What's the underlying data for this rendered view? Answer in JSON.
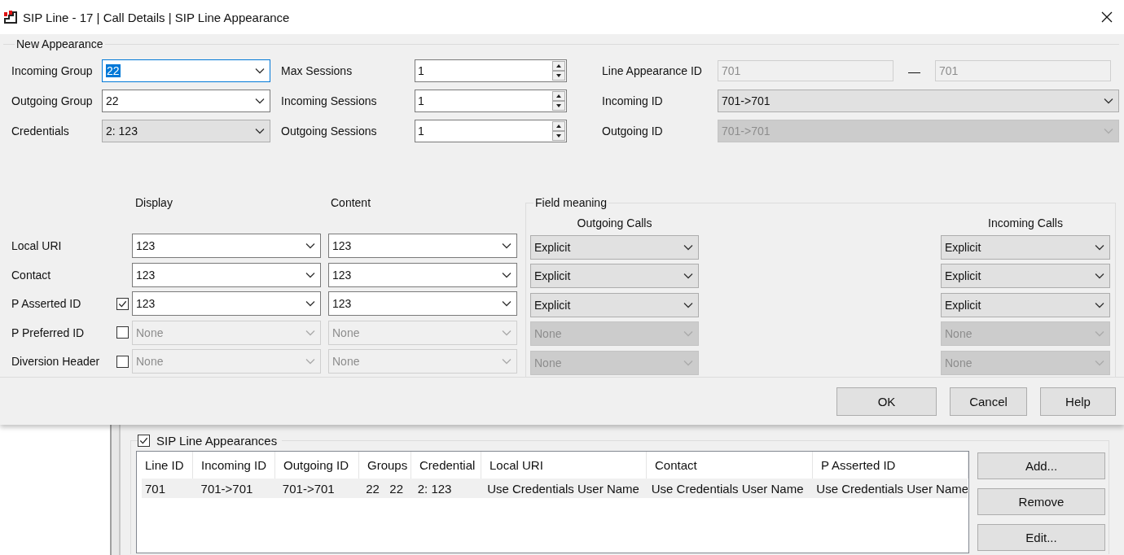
{
  "window": {
    "title": "SIP Line - 17 | Call Details | SIP Line Appearance"
  },
  "new_appearance": {
    "title": "New Appearance",
    "groups": [
      {
        "label": "Incoming Group",
        "kind": "combo",
        "value": "22",
        "focused": true,
        "disabled": false
      },
      {
        "label": "Outgoing Group",
        "kind": "combo",
        "value": "22",
        "focused": false,
        "disabled": false
      },
      {
        "label": "Credentials",
        "kind": "list",
        "value": "2: 123",
        "focused": false,
        "disabled": false
      }
    ],
    "sessions": [
      {
        "label": "Max Sessions",
        "kind": "spin",
        "value": "1"
      },
      {
        "label": "Incoming Sessions",
        "kind": "spin",
        "value": "1"
      },
      {
        "label": "Outgoing  Sessions",
        "kind": "spin",
        "value": "1"
      }
    ],
    "ids": [
      {
        "label": "Line Appearance ID",
        "kind": "range",
        "separator": "—",
        "fields": [
          {
            "value": "701",
            "disabled": true
          },
          {
            "value": "701",
            "disabled": true
          }
        ]
      },
      {
        "label": "Incoming ID",
        "kind": "list",
        "value": "701->701",
        "disabled": false
      },
      {
        "label": "Outgoing ID",
        "kind": "list",
        "value": "701->701",
        "disabled": true
      }
    ]
  },
  "headers": {
    "display": "Display",
    "content": "Content"
  },
  "field_meaning": {
    "title": "Field meaning",
    "outgoing": "Outgoing Calls",
    "incoming": "Incoming Calls"
  },
  "header_rows": [
    {
      "label": "Local URI",
      "display": {
        "value": "123",
        "disabled": false
      },
      "content": {
        "value": "123",
        "disabled": false
      },
      "outgoing": {
        "value": "Explicit",
        "disabled": false
      },
      "incoming": {
        "value": "Explicit",
        "disabled": false
      }
    },
    {
      "label": "Contact",
      "display": {
        "value": "123",
        "disabled": false
      },
      "content": {
        "value": "123",
        "disabled": false
      },
      "outgoing": {
        "value": "Explicit",
        "disabled": false
      },
      "incoming": {
        "value": "Explicit",
        "disabled": false
      }
    },
    {
      "label": "P Asserted ID",
      "checkbox": {
        "checked": true
      },
      "display": {
        "value": "123",
        "disabled": false
      },
      "content": {
        "value": "123",
        "disabled": false
      },
      "outgoing": {
        "value": "Explicit",
        "disabled": false
      },
      "incoming": {
        "value": "Explicit",
        "disabled": false
      }
    },
    {
      "label": "P Preferred  ID",
      "checkbox": {
        "checked": false
      },
      "display": {
        "value": "None",
        "disabled": true
      },
      "content": {
        "value": "None",
        "disabled": true
      },
      "outgoing": {
        "value": "None",
        "disabled": true
      },
      "incoming": {
        "value": "None",
        "disabled": true
      }
    },
    {
      "label": "Diversion Header",
      "checkbox": {
        "checked": false
      },
      "display": {
        "value": "None",
        "disabled": true
      },
      "content": {
        "value": "None",
        "disabled": true
      },
      "outgoing": {
        "value": "None",
        "disabled": true
      },
      "incoming": {
        "value": "None",
        "disabled": true
      }
    }
  ],
  "buttons": [
    "OK",
    "Cancel",
    "Help"
  ],
  "appearances": {
    "title": "SIP Line Appearances",
    "checked": true,
    "columns": [
      "Line ID",
      "Incoming ID",
      "Outgoing ID",
      "Groups",
      "Credential",
      "Local URI",
      "Contact",
      "P Asserted ID"
    ],
    "rows": [
      {
        "selected": true,
        "cells": [
          "701",
          "701->701",
          "701->701",
          "22   22",
          "2: 123",
          "Use Credentials User Name",
          "Use Credentials User Name",
          "Use Credentials User Name"
        ]
      }
    ],
    "buttons": [
      "Add...",
      "Remove",
      "Edit..."
    ]
  }
}
